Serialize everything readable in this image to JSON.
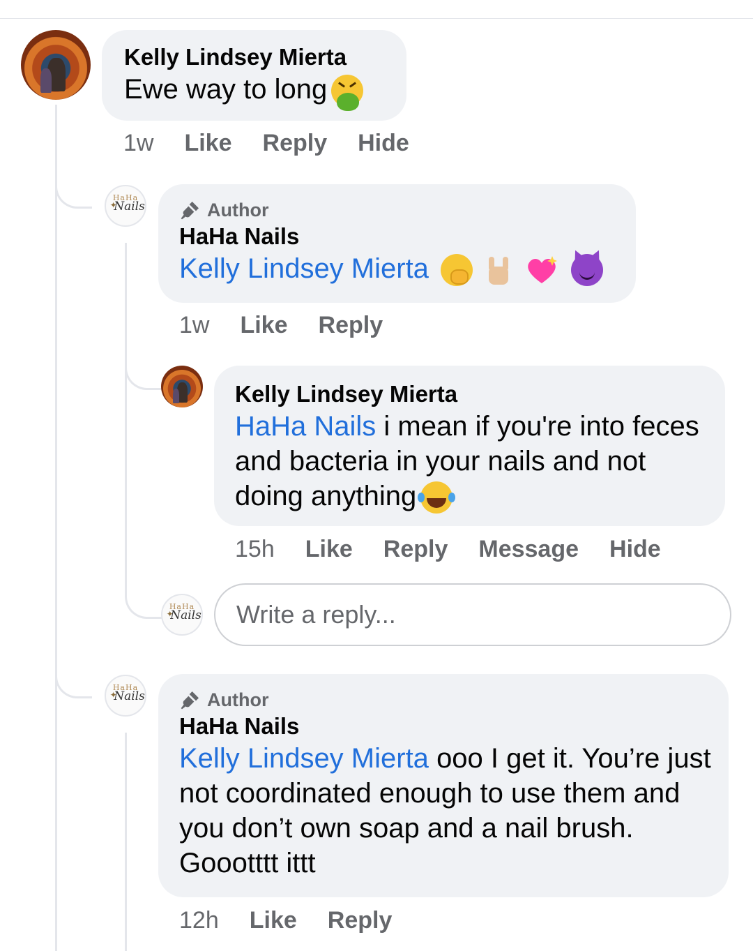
{
  "comments": [
    {
      "name": "Kelly Lindsey Mierta",
      "text": "Ewe way to long",
      "emoji": [
        "nauseated-vomit-emoji"
      ],
      "time": "1w",
      "actions": [
        "Like",
        "Reply",
        "Hide"
      ]
    },
    {
      "badge": "Author",
      "name": "HaHa Nails",
      "mention": "Kelly Lindsey Mierta",
      "text": "",
      "emoji": [
        "yawning-face-emoji",
        "rock-on-hand-emoji",
        "sparkling-heart-emoji",
        "smiling-devil-emoji"
      ],
      "time": "1w",
      "actions": [
        "Like",
        "Reply"
      ]
    },
    {
      "name": "Kelly Lindsey Mierta",
      "mention": "HaHa Nails",
      "text": "i mean if you're into feces and bacteria in your nails and not doing anything",
      "emoji": [
        "tears-of-joy-emoji"
      ],
      "time": "15h",
      "actions": [
        "Like",
        "Reply",
        "Message",
        "Hide"
      ]
    },
    {
      "badge": "Author",
      "name": "HaHa Nails",
      "mention": "Kelly Lindsey Mierta",
      "text": "ooo I get it. You’re just not coordinated enough to use them and you don’t own soap and a nail brush. Goootttt ittt",
      "time": "12h",
      "actions": [
        "Like",
        "Reply"
      ]
    }
  ],
  "reply_box": {
    "placeholder": "Write a reply..."
  },
  "brand_avatar": {
    "top": "HaHa",
    "script": "Nails"
  },
  "colors": {
    "bubble": "#f0f2f5",
    "mention": "#216fdb",
    "meta": "#65676b",
    "thread": "#e4e6eb"
  }
}
